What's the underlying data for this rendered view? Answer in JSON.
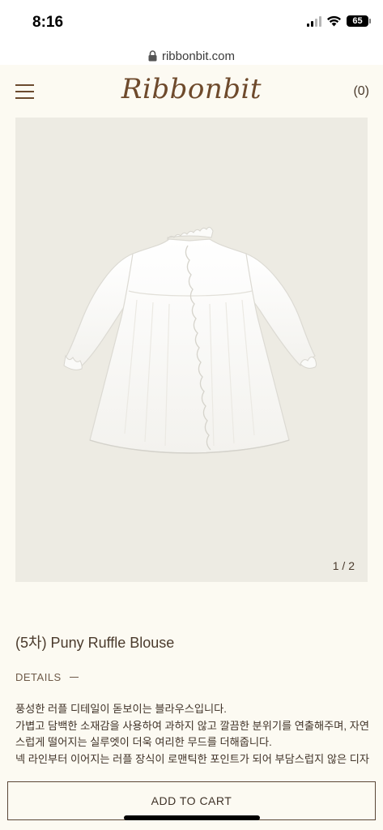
{
  "status_bar": {
    "time": "8:16",
    "battery": "65",
    "icons": [
      "cellular-signal-icon",
      "wifi-icon",
      "battery-icon"
    ]
  },
  "browser": {
    "url": "ribbonbit.com",
    "lock_icon": "lock-icon"
  },
  "header": {
    "menu_icon": "hamburger-menu-icon",
    "logo": "Ribbonbit",
    "cart_count": "(0)"
  },
  "product": {
    "image_subject": "white-ruffle-blouse",
    "slide_counter": "1 / 2",
    "title": "(5차) Puny Ruffle Blouse",
    "details_label": "DETAILS",
    "description_lines": [
      "풍성한 러플 디테일이 돋보이는 블라우스입니다.",
      "가볍고 담백한 소재감을 사용하여 과하지 않고 깔끔한 분위기를 연출해주며, 자연",
      "스럽게 떨어지는 실루엣이 더욱 여리한 무드를 더해줍니다.",
      "넥 라인부터 이어지는 러플 장식이 로맨틱한 포인트가 되어 부담스럽지 않은 디자"
    ]
  },
  "cta": {
    "add_to_cart": "ADD TO CART"
  },
  "colors": {
    "background": "#fcfaf2",
    "image_background": "#edebe3",
    "brand_brown": "#6e4a2c",
    "text": "#4a3a2c"
  }
}
